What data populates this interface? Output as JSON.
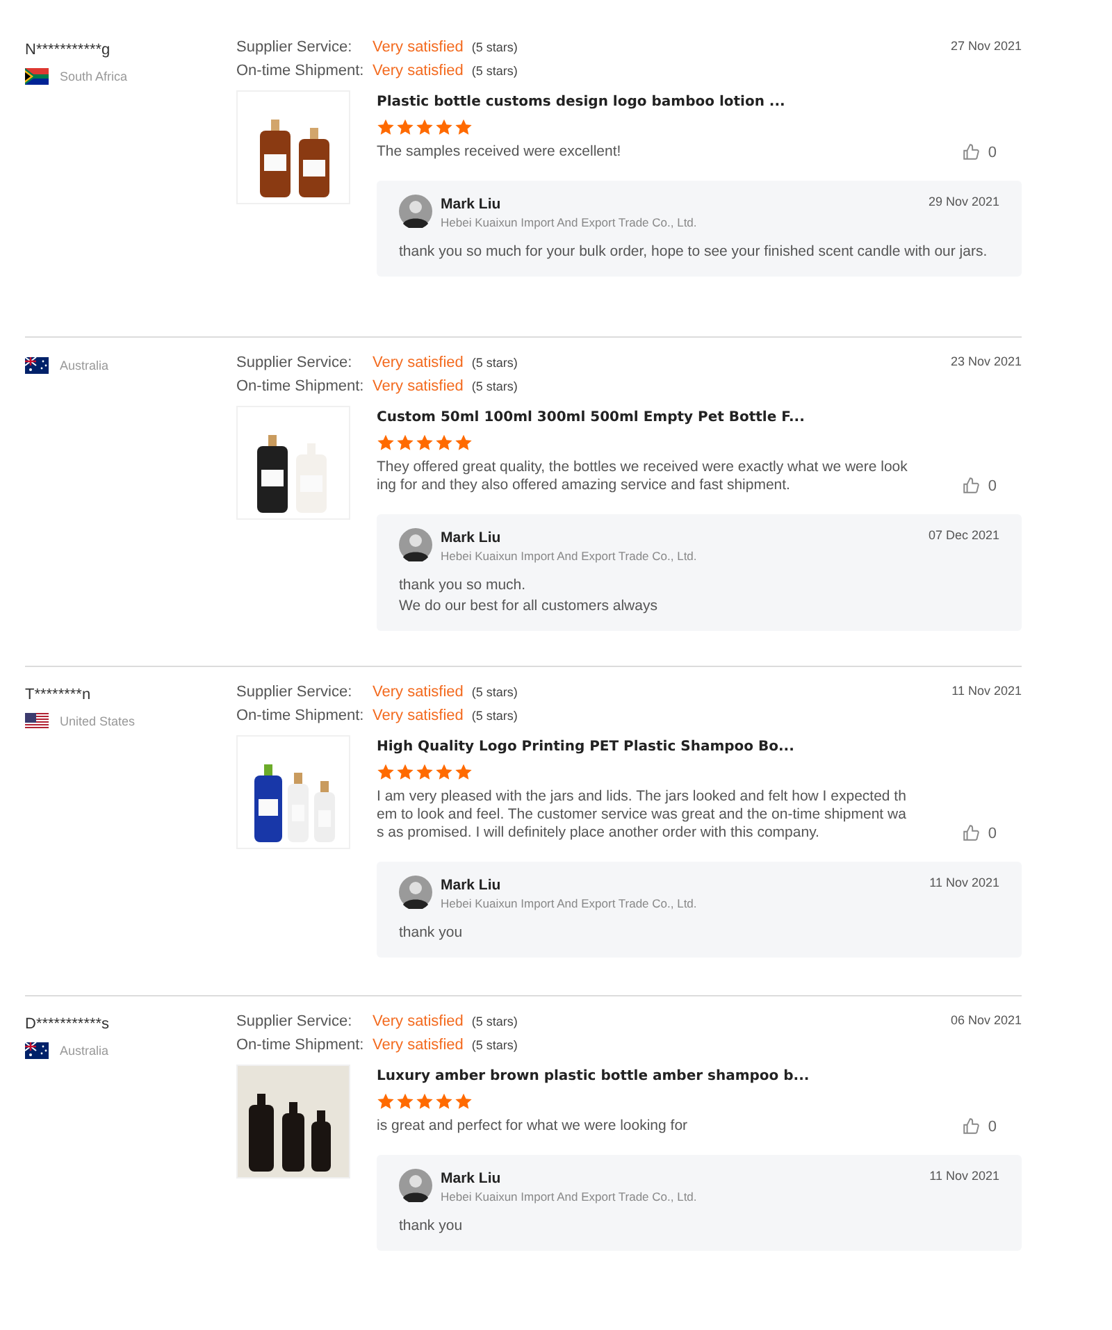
{
  "reviews": [
    {
      "buyer": "N***********g",
      "country": "South Africa",
      "flag": {
        "kind": "za"
      },
      "ratings": [
        {
          "label": "Supplier Service:",
          "value": "Very satisfied",
          "stars_text": "(5 stars)"
        },
        {
          "label": "On-time Shipment:",
          "value": "Very satisfied",
          "stars_text": "(5 stars)"
        }
      ],
      "date": "27 Nov 2021",
      "product": {
        "kind": "picture",
        "title": "Plastic bottle customs design logo bamboo lotion ...",
        "stars": 5,
        "text": "The samples received were excellent!",
        "likes": "0"
      },
      "reply": {
        "name": "Mark Liu",
        "company": "Hebei Kuaixun Import And Export Trade Co., Ltd.",
        "date": "29 Nov 2021",
        "lines": [
          "thank you so much for your bulk order, hope to see your finished scent candle with our jars."
        ]
      }
    },
    {
      "country": "Australia",
      "flag": {
        "kind": "au"
      },
      "ratings": [
        {
          "label": "Supplier Service:",
          "value": "Very satisfied",
          "stars_text": "(5 stars)"
        },
        {
          "label": "On-time Shipment:",
          "value": "Very satisfied",
          "stars_text": "(5 stars)"
        }
      ],
      "date": "23 Nov 2021",
      "product": {
        "kind": "picture",
        "title": "Custom 50ml 100ml 300ml 500ml Empty Pet Bottle F...",
        "stars": 5,
        "text": "They offered great quality, the bottles we received were exactly what we were looking for and they also offered amazing service and fast shipment.",
        "likes": "0"
      },
      "reply": {
        "name": "Mark Liu",
        "company": "Hebei Kuaixun Import And Export Trade Co., Ltd.",
        "date": "07 Dec 2021",
        "lines": [
          "thank you so much.",
          "We do our best for all customers always"
        ]
      }
    },
    {
      "buyer": "T********n",
      "country": "United States",
      "flag": {
        "kind": "us"
      },
      "ratings": [
        {
          "label": "Supplier Service:",
          "value": "Very satisfied",
          "stars_text": "(5 stars)"
        },
        {
          "label": "On-time Shipment:",
          "value": "Very satisfied",
          "stars_text": "(5 stars)"
        }
      ],
      "date": "11 Nov 2021",
      "product": {
        "kind": "picture",
        "title": "High Quality Logo Printing PET Plastic Shampoo Bo...",
        "stars": 5,
        "text": "I am very pleased with the jars and lids.  The jars looked and felt how I expected them to look and feel. The customer service was great and the on-time shipment was as promised. I will definitely place another order with this company.",
        "likes": "0"
      },
      "reply": {
        "name": "Mark Liu",
        "company": "Hebei Kuaixun Import And Export Trade Co., Ltd.",
        "date": "11 Nov 2021",
        "lines": [
          "thank you"
        ]
      }
    },
    {
      "buyer": "D***********s",
      "country": "Australia",
      "flag": {
        "kind": "au"
      },
      "ratings": [
        {
          "label": "Supplier Service:",
          "value": "Very satisfied",
          "stars_text": "(5 stars)"
        },
        {
          "label": "On-time Shipment:",
          "value": "Very satisfied",
          "stars_text": "(5 stars)"
        }
      ],
      "date": "06 Nov 2021",
      "product": {
        "kind": "picture",
        "title": "Luxury amber brown plastic bottle amber shampoo b...",
        "stars": 5,
        "text": "is great and perfect for what we were looking for",
        "likes": "0"
      },
      "reply": {
        "name": "Mark Liu",
        "company": "Hebei Kuaixun Import And Export Trade Co., Ltd.",
        "date": "11 Nov 2021",
        "lines": [
          "thank you"
        ]
      }
    }
  ]
}
